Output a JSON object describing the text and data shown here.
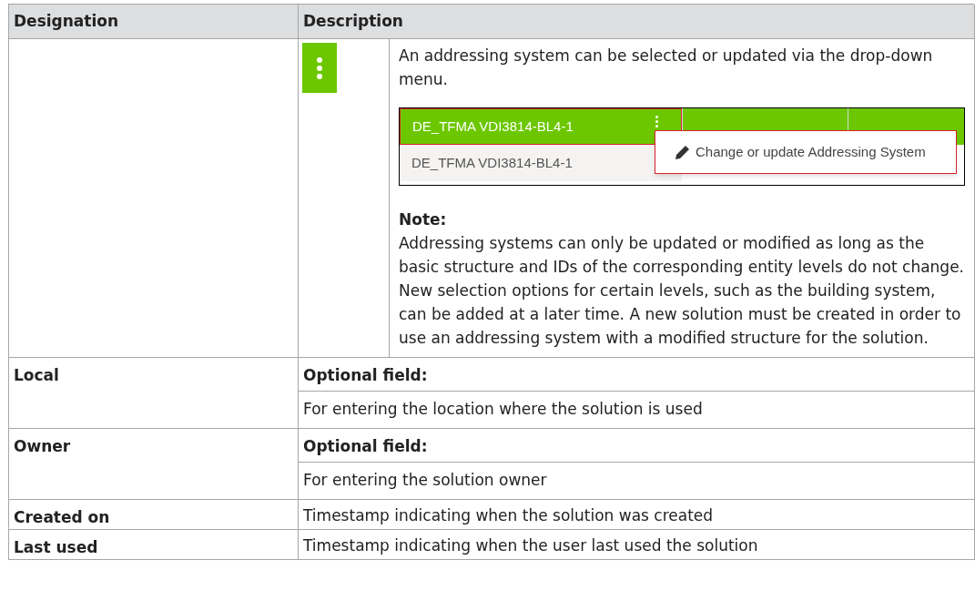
{
  "table": {
    "columns": [
      "Designation",
      "Description"
    ],
    "rows": [
      {
        "kind": "addressing",
        "description": "An addressing system can be selected or updated via the drop-down menu.",
        "screenshot": {
          "rows": [
            {
              "cells": [
                "DE_TFMA VDI3814-BL4-1"
              ],
              "selected": true
            },
            {
              "cells": [
                "DE_TFMA VDI3814-BL4-1"
              ],
              "selected": false
            }
          ],
          "menu_item": "Change or update Addressing System"
        },
        "note_title": "Note:",
        "note": "Addressing systems can only be updated or modified as long as the basic structure and IDs of the corresponding entity levels do not change. New selection options for certain levels, such as the building system, can be added at a later time. A new solution must be created in order to use an addressing system with a modified structure for the solution."
      },
      {
        "kind": "optional",
        "designation": "Local",
        "heading": "Optional field:",
        "description": "For entering the location where the solution is used"
      },
      {
        "kind": "optional",
        "designation": "Owner",
        "heading": "Optional field:",
        "description": "For entering the solution owner"
      },
      {
        "kind": "plain",
        "designation": "Created on",
        "description": "Timestamp indicating when the solution was created"
      },
      {
        "kind": "plain",
        "designation": "Last used",
        "description": "Timestamp indicating when the user last used the solution"
      }
    ]
  }
}
